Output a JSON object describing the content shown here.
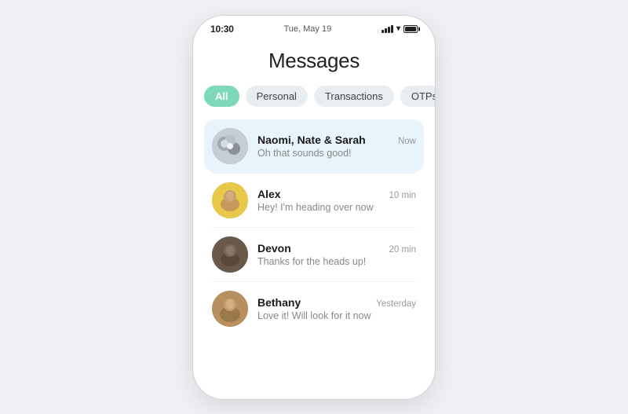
{
  "statusBar": {
    "time": "10:30",
    "date": "Tue, May 19"
  },
  "pageTitle": "Messages",
  "filterTabs": [
    {
      "id": "all",
      "label": "All",
      "active": true
    },
    {
      "id": "personal",
      "label": "Personal",
      "active": false
    },
    {
      "id": "transactions",
      "label": "Transactions",
      "active": false
    },
    {
      "id": "otps",
      "label": "OTPs",
      "active": false
    }
  ],
  "messages": [
    {
      "id": "naomi",
      "name": "Naomi, Nate & Sarah",
      "preview": "Oh that sounds good!",
      "time": "Now",
      "highlighted": true,
      "avatarType": "group"
    },
    {
      "id": "alex",
      "name": "Alex",
      "preview": "Hey! I'm heading over now",
      "time": "10 min",
      "highlighted": false,
      "avatarType": "alex"
    },
    {
      "id": "devon",
      "name": "Devon",
      "preview": "Thanks for the heads up!",
      "time": "20 min",
      "highlighted": false,
      "avatarType": "devon"
    },
    {
      "id": "bethany",
      "name": "Bethany",
      "preview": "Love it! Will look for it now",
      "time": "Yesterday",
      "highlighted": false,
      "avatarType": "bethany"
    }
  ]
}
